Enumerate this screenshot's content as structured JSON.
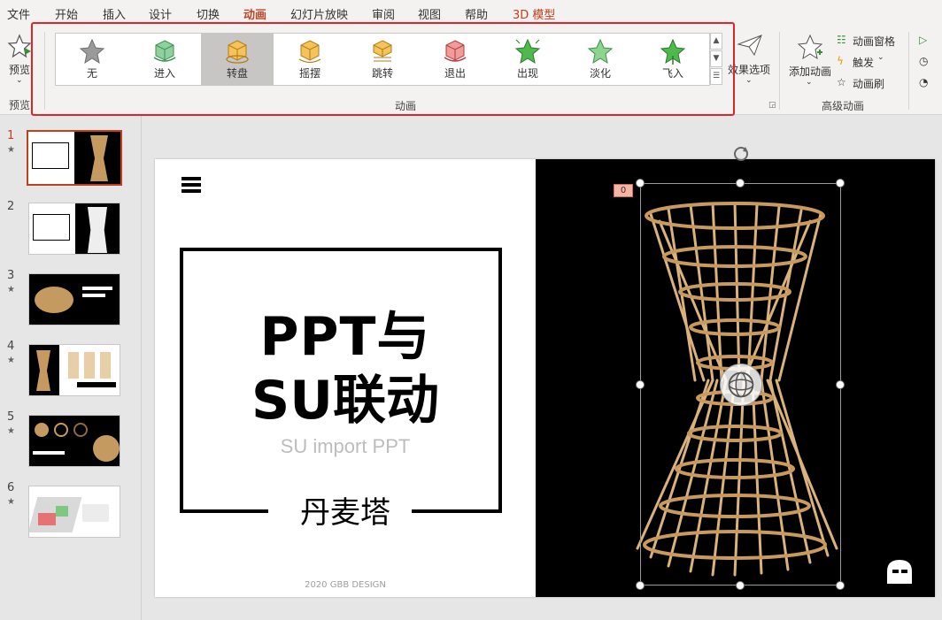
{
  "menu": {
    "tabs": [
      "文件",
      "开始",
      "插入",
      "设计",
      "切换",
      "动画",
      "幻灯片放映",
      "审阅",
      "视图",
      "帮助",
      "3D 模型"
    ],
    "active_tab": "动画"
  },
  "ribbon": {
    "preview": {
      "button": "预览",
      "group": "预览"
    },
    "animation_group_label": "动画",
    "gallery": [
      {
        "label": "无",
        "icon": "none-star-icon"
      },
      {
        "label": "进入",
        "icon": "enter-cube-icon"
      },
      {
        "label": "转盘",
        "icon": "turntable-cube-icon"
      },
      {
        "label": "摇摆",
        "icon": "swing-cube-icon"
      },
      {
        "label": "跳转",
        "icon": "jump-cube-icon"
      },
      {
        "label": "退出",
        "icon": "exit-cube-icon"
      },
      {
        "label": "出现",
        "icon": "appear-star-icon"
      },
      {
        "label": "淡化",
        "icon": "fade-star-icon"
      },
      {
        "label": "飞入",
        "icon": "fly-in-star-icon"
      }
    ],
    "selected_effect": "转盘",
    "effect_options": "效果选项",
    "advanced": {
      "add_animation": "添加动画",
      "animation_pane": "动画窗格",
      "trigger": "触发",
      "animation_painter": "动画刷",
      "group": "高级动画"
    }
  },
  "thumbnails": {
    "numbers": [
      "1",
      "2",
      "3",
      "4",
      "5",
      "6"
    ],
    "selected": "1"
  },
  "slide": {
    "title_line1": "PPT与",
    "title_line2": "SU联动",
    "subtitle": "SU import PPT",
    "name": "丹麦塔",
    "footer": "2020 GBB DESIGN",
    "animation_badge": "0"
  },
  "colors": {
    "accent": "#b7472a",
    "highlight_box": "#e0242a",
    "slide_dark": "#000000",
    "wood": "#d9b27c"
  }
}
